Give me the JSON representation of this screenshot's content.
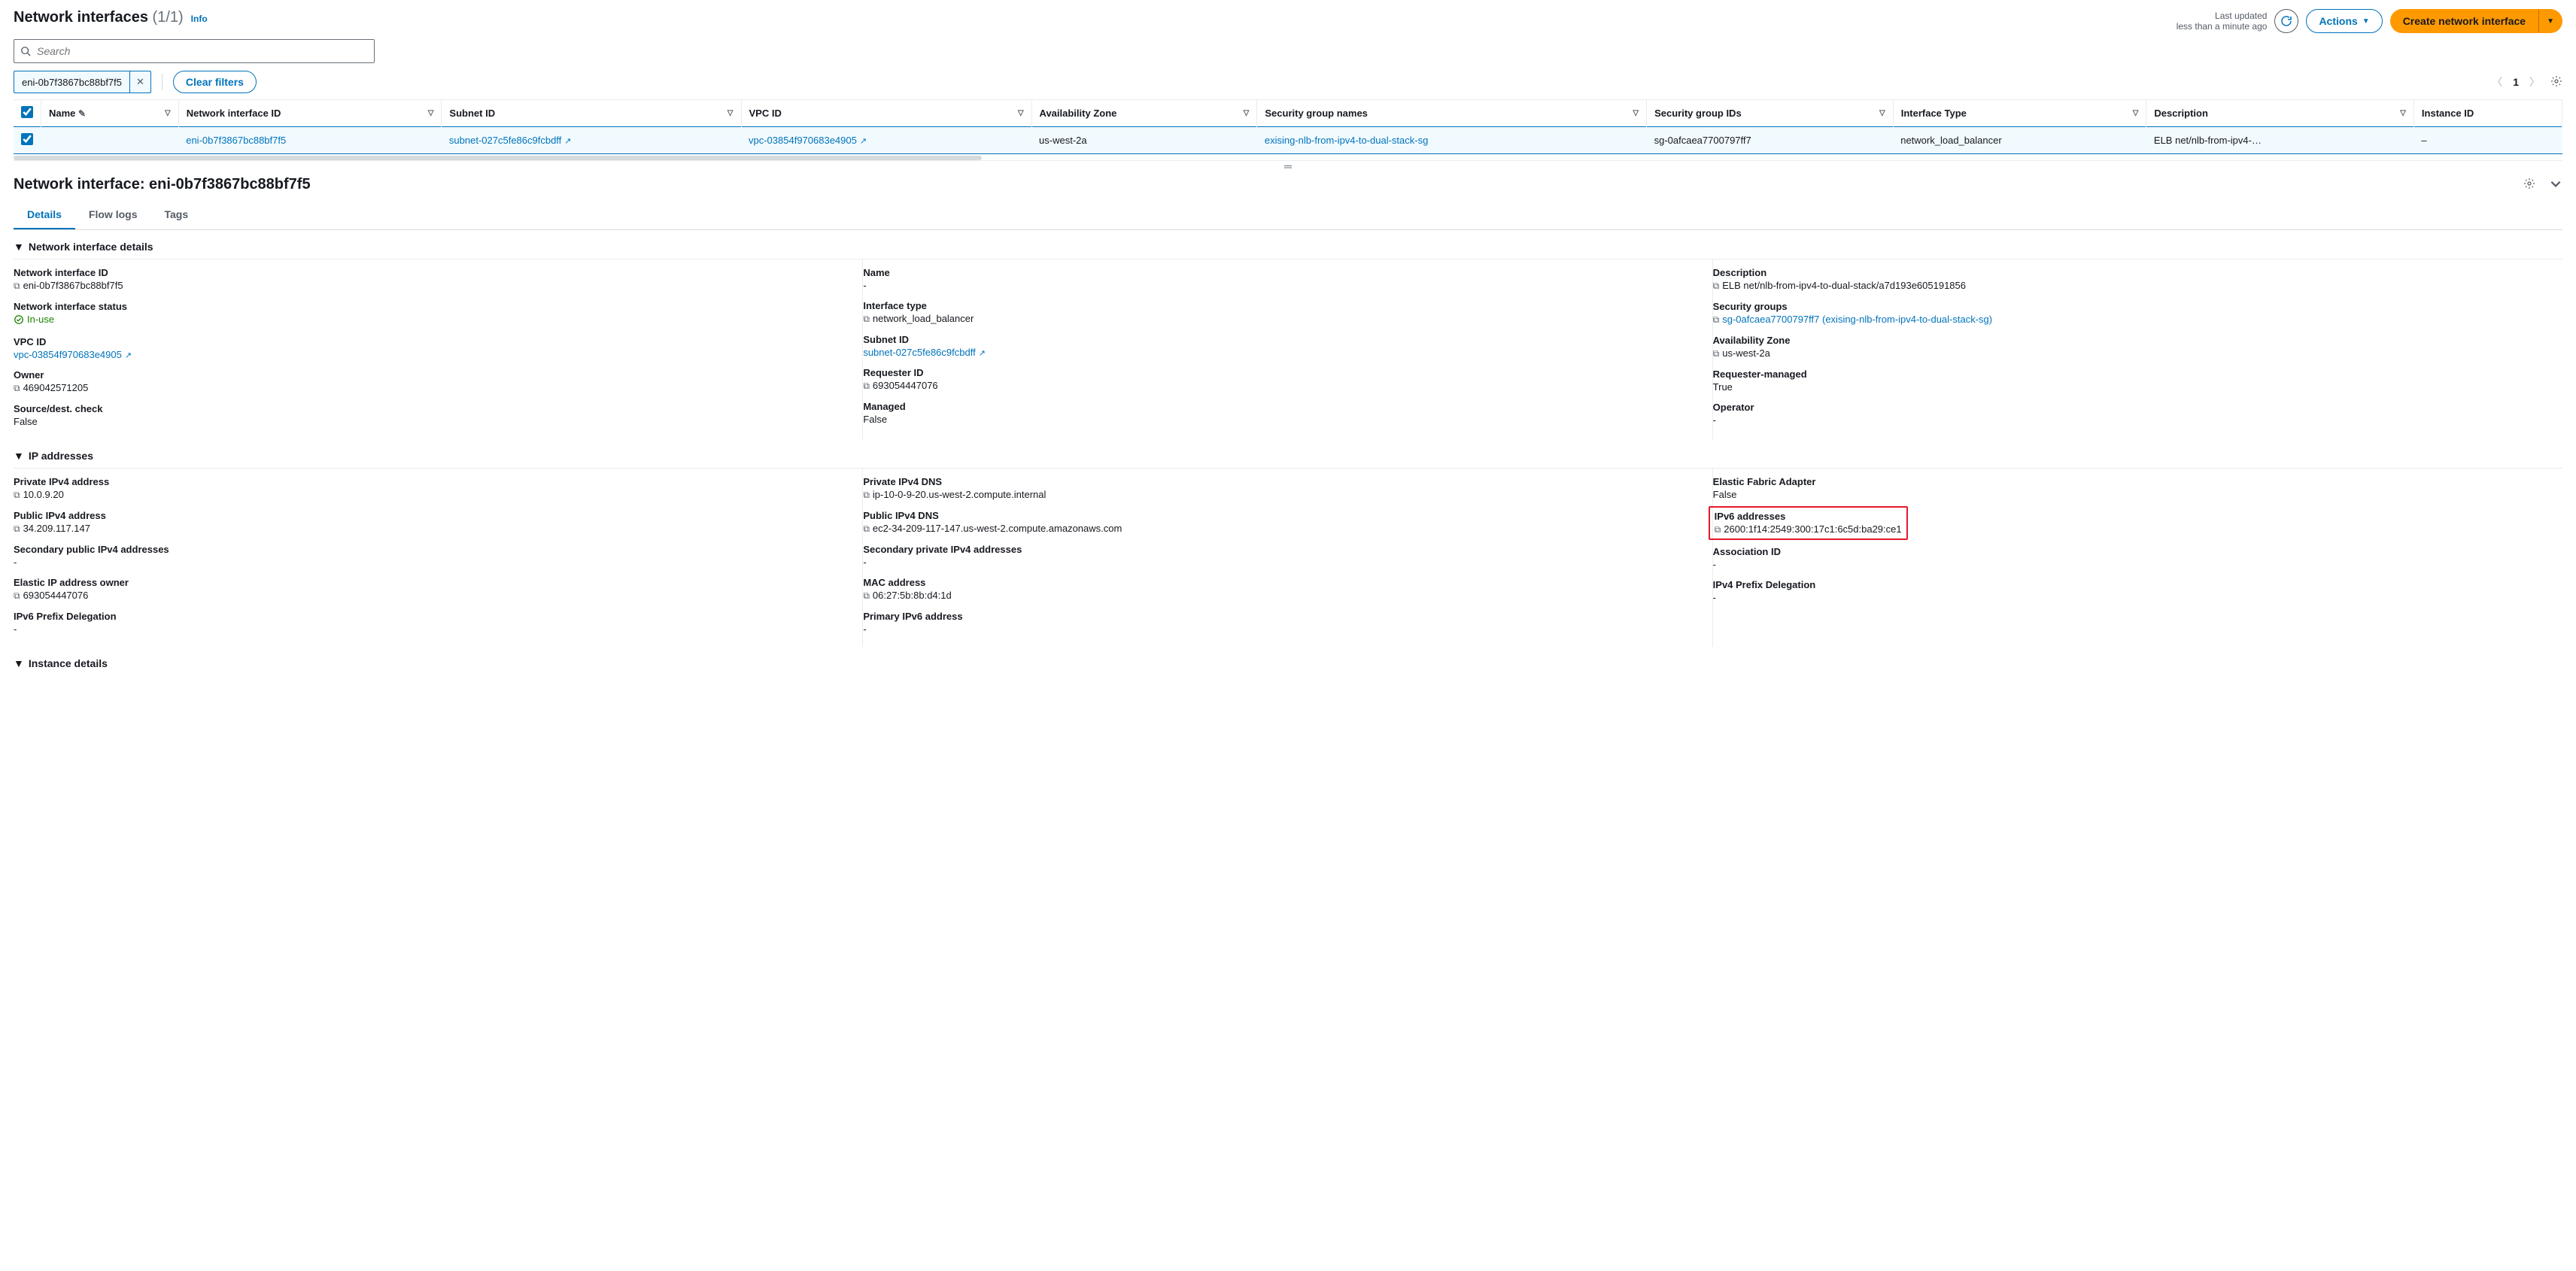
{
  "header": {
    "title": "Network interfaces",
    "count": "(1/1)",
    "info": "Info",
    "last_updated_line1": "Last updated",
    "last_updated_line2": "less than a minute ago",
    "actions": "Actions",
    "create": "Create network interface"
  },
  "search": {
    "placeholder": "Search"
  },
  "filter": {
    "chip": "eni-0b7f3867bc88bf7f5",
    "clear": "Clear filters",
    "page": "1"
  },
  "columns": {
    "name": "Name",
    "eni": "Network interface ID",
    "subnet": "Subnet ID",
    "vpc": "VPC ID",
    "az": "Availability Zone",
    "sgnames": "Security group names",
    "sgids": "Security group IDs",
    "iftype": "Interface Type",
    "desc": "Description",
    "instance": "Instance ID"
  },
  "row": {
    "name": "",
    "eni": "eni-0b7f3867bc88bf7f5",
    "subnet": "subnet-027c5fe86c9fcbdff",
    "vpc": "vpc-03854f970683e4905",
    "az": "us-west-2a",
    "sgnames": "exising-nlb-from-ipv4-to-dual-stack-sg",
    "sgids": "sg-0afcaea7700797ff7",
    "iftype": "network_load_balancer",
    "desc": "ELB net/nlb-from-ipv4-…",
    "instance": "–"
  },
  "detail": {
    "title": "Network interface: eni-0b7f3867bc88bf7f5",
    "tabs": {
      "details": "Details",
      "flowlogs": "Flow logs",
      "tags": "Tags"
    },
    "sec_ni": "Network interface details",
    "sec_ip": "IP addresses",
    "sec_inst": "Instance details",
    "ni": {
      "eni_k": "Network interface ID",
      "eni_v": "eni-0b7f3867bc88bf7f5",
      "name_k": "Name",
      "name_v": "-",
      "desc_k": "Description",
      "desc_v": "ELB net/nlb-from-ipv4-to-dual-stack/a7d193e605191856",
      "status_k": "Network interface status",
      "status_v": "In-use",
      "iftype_k": "Interface type",
      "iftype_v": "network_load_balancer",
      "sg_k": "Security groups",
      "sg_v": "sg-0afcaea7700797ff7 (exising-nlb-from-ipv4-to-dual-stack-sg)",
      "vpc_k": "VPC ID",
      "vpc_v": "vpc-03854f970683e4905",
      "subnet_k": "Subnet ID",
      "subnet_v": "subnet-027c5fe86c9fcbdff",
      "az_k": "Availability Zone",
      "az_v": "us-west-2a",
      "owner_k": "Owner",
      "owner_v": "469042571205",
      "req_k": "Requester ID",
      "req_v": "693054447076",
      "reqm_k": "Requester-managed",
      "reqm_v": "True",
      "sdc_k": "Source/dest. check",
      "sdc_v": "False",
      "mgd_k": "Managed",
      "mgd_v": "False",
      "op_k": "Operator",
      "op_v": "-"
    },
    "ip": {
      "p4_k": "Private IPv4 address",
      "p4_v": "10.0.9.20",
      "p4dns_k": "Private IPv4 DNS",
      "p4dns_v": "ip-10-0-9-20.us-west-2.compute.internal",
      "efa_k": "Elastic Fabric Adapter",
      "efa_v": "False",
      "pub4_k": "Public IPv4 address",
      "pub4_v": "34.209.117.147",
      "pub4dns_k": "Public IPv4 DNS",
      "pub4dns_v": "ec2-34-209-117-147.us-west-2.compute.amazonaws.com",
      "ipv6_k": "IPv6 addresses",
      "ipv6_v": "2600:1f14:2549:300:17c1:6c5d:ba29:ce1",
      "sec_pub_k": "Secondary public IPv4 addresses",
      "sec_pub_v": "-",
      "sec_priv_k": "Secondary private IPv4 addresses",
      "sec_priv_v": "-",
      "assoc_k": "Association ID",
      "assoc_v": "-",
      "eip_owner_k": "Elastic IP address owner",
      "eip_owner_v": "693054447076",
      "mac_k": "MAC address",
      "mac_v": "06:27:5b:8b:d4:1d",
      "ipv4pd_k": "IPv4 Prefix Delegation",
      "ipv4pd_v": "-",
      "ipv6pd_k": "IPv6 Prefix Delegation",
      "ipv6pd_v": "-",
      "primv6_k": "Primary IPv6 address",
      "primv6_v": "-"
    }
  }
}
